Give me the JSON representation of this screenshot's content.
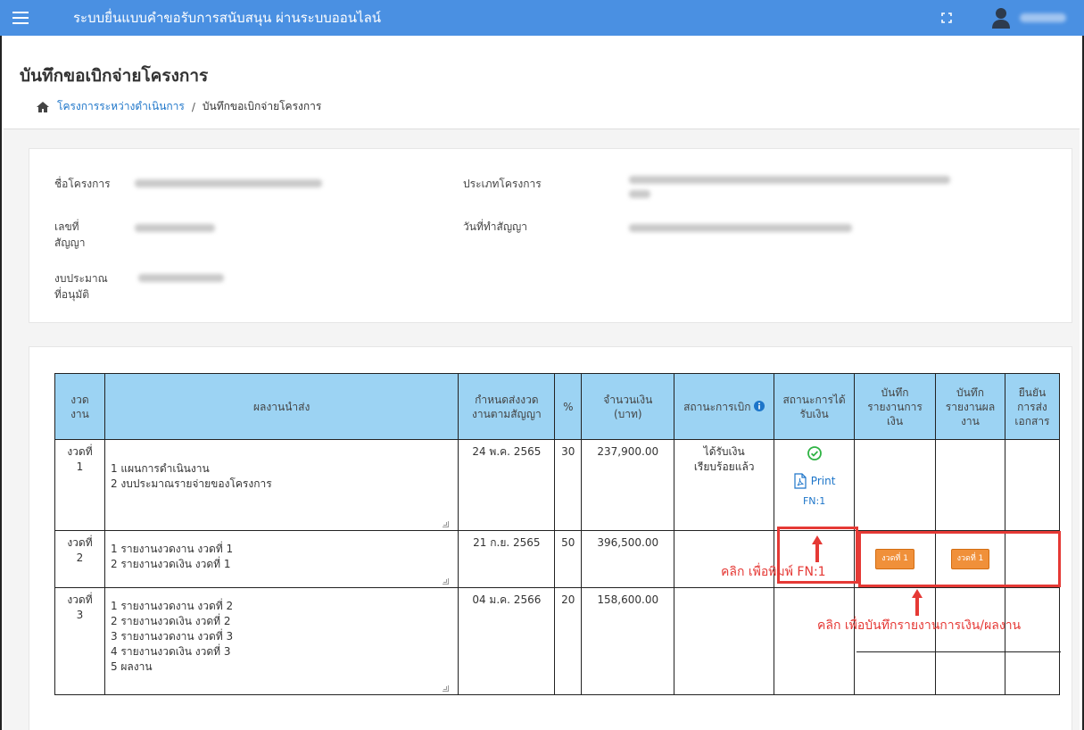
{
  "topbar": {
    "app_title": "ระบบยื่นแบบคำขอรับการสนับสนุน ผ่านระบบออนไลน์",
    "menu_icon": "hamburger-icon",
    "fullscreen_icon": "fullscreen-icon",
    "user_icon": "user-icon",
    "colors": {
      "bar": "#4a90e2"
    }
  },
  "page": {
    "title": "บันทึกขอเบิกจ่ายโครงการ",
    "breadcrumb": {
      "home_icon": "home-icon",
      "link": "โครงการระหว่างดำเนินการ",
      "separator": "/",
      "current": "บันทึกขอเบิกจ่ายโครงการ"
    }
  },
  "info": {
    "project_name_label": "ชื่อโครงการ",
    "project_type_label": "ประเภทโครงการ",
    "contract_no_label_1": "เลขที่",
    "contract_no_label_2": "สัญญา",
    "contract_date_label": "วันที่ทำสัญญา",
    "budget_label_1": "งบประมาณ",
    "budget_label_2": "ที่อนุมัติ"
  },
  "table": {
    "headers": {
      "period_1": "งวด",
      "period_2": "งาน",
      "deliverable": "ผลงานนำส่ง",
      "due_1": "กำหนดส่งงวด",
      "due_2": "งานตามสัญญา",
      "percent": "%",
      "amount_1": "จำนวนเงิน",
      "amount_2": "(บาท)",
      "status_withdraw": "สถานะการเบิก",
      "status_received_1": "สถานะการได้",
      "status_received_2": "รับเงิน",
      "fin_report_1": "บันทึก",
      "fin_report_2": "รายงานการ",
      "fin_report_3": "เงิน",
      "work_report_1": "บันทึก",
      "work_report_2": "รายงานผล",
      "work_report_3": "งาน",
      "confirm_1": "ยืนยัน",
      "confirm_2": "การส่ง",
      "confirm_3": "เอกสาร"
    },
    "info_icon": "info-icon",
    "rows": [
      {
        "period_1": "งวดที่",
        "period_2": "1",
        "deliverables": [
          "1 แผนการดำเนินงาน",
          "2 งบประมาณรายจ่ายของโครงการ"
        ],
        "due": "24 พ.ค. 2565",
        "percent": "30",
        "amount": "237,900.00",
        "withdraw_1": "ได้รับเงิน",
        "withdraw_2": "เรียบร้อยแล้ว",
        "received_icon": "check-circle-icon",
        "print_label": "Print",
        "print_sub": "FN:1",
        "print_icon": "pdf-icon"
      },
      {
        "period_1": "งวดที่",
        "period_2": "2",
        "deliverables": [
          "1 รายงานงวดงาน งวดที่ 1",
          "2 รายงานงวดเงิน งวดที่ 1"
        ],
        "due": "21 ก.ย. 2565",
        "percent": "50",
        "amount": "396,500.00",
        "fin_badge": "งวดที่ 1",
        "work_badge": "งวดที่ 1"
      },
      {
        "period_1": "งวดที่",
        "period_2": "3",
        "deliverables": [
          "1 รายงานงวดงาน งวดที่ 2",
          "2 รายงานงวดเงิน งวดที่ 2",
          "3 รายงานงวดงาน งวดที่ 3",
          "4 รายงานงวดเงิน งวดที่ 3",
          "5 ผลงาน"
        ],
        "due": "04 ม.ค. 2566",
        "percent": "20",
        "amount": "158,600.00"
      }
    ]
  },
  "annotations": {
    "print_hint": "คลิก เพื่อพิมพ์ FN:1",
    "report_hint": "คลิก เพื่อบันทึกรายงานการเงิน/ผลงาน",
    "color": "#e53935"
  }
}
